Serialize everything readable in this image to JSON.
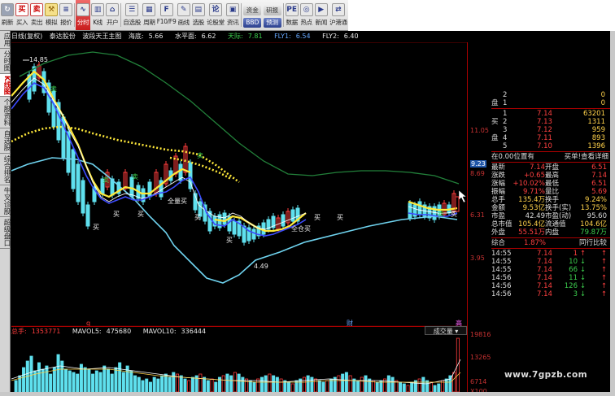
{
  "toolbar": {
    "items": [
      {
        "icon": "refresh-icon",
        "glyph": "↻",
        "label": "刷新",
        "style": "gray"
      },
      {
        "icon": "buy-icon",
        "glyph": "买",
        "label": "买入",
        "style": "reddish"
      },
      {
        "icon": "sell-icon",
        "glyph": "卖",
        "label": "卖出",
        "style": "reddish"
      },
      {
        "icon": "simulate-icon",
        "glyph": "⚒",
        "label": "模拟",
        "style": "gold"
      },
      {
        "icon": "quote-icon",
        "glyph": "≡",
        "label": "报价",
        "style": ""
      },
      {
        "icon": "timeshare-icon",
        "glyph": "∿",
        "label": "分时",
        "style": "active"
      },
      {
        "icon": "kline-icon",
        "glyph": "▥",
        "label": "K线",
        "style": ""
      },
      {
        "icon": "home-icon",
        "glyph": "⌂",
        "label": "开户",
        "style": ""
      },
      {
        "icon": "watchlist-icon",
        "glyph": "☰",
        "label": "自选股",
        "style": ""
      },
      {
        "icon": "period-icon",
        "glyph": "▦",
        "label": "周期",
        "style": ""
      },
      {
        "icon": "f10-icon",
        "glyph": "F",
        "label": "F10/F9",
        "style": ""
      },
      {
        "icon": "draw-icon",
        "glyph": "✎",
        "label": "画线",
        "style": ""
      },
      {
        "icon": "select-stock-icon",
        "glyph": "▤",
        "label": "选股",
        "style": ""
      },
      {
        "icon": "forum-icon",
        "glyph": "论",
        "label": "论股堂",
        "style": ""
      },
      {
        "icon": "news-icon",
        "glyph": "▣",
        "label": "资讯",
        "style": ""
      }
    ],
    "pills": [
      {
        "icon": "bbd-icon",
        "top": "资金",
        "bottom": "BBD"
      },
      {
        "icon": "research-icon",
        "top": "研报",
        "bottom": "预测"
      }
    ],
    "tail": [
      {
        "icon": "pe-icon",
        "glyph": "PE",
        "label": "数据"
      },
      {
        "icon": "hotspot-icon",
        "glyph": "◎",
        "label": "热点"
      },
      {
        "icon": "news-tv-icon",
        "glyph": "▶",
        "label": "新闻"
      },
      {
        "icon": "hk-connect-icon",
        "glyph": "⇄",
        "label": "沪港通"
      }
    ]
  },
  "sidebar": {
    "tabs": [
      {
        "label": "应用",
        "active": false
      },
      {
        "label": "分时图",
        "active": false
      },
      {
        "label": "K线图",
        "active": true
      },
      {
        "label": "个股资料",
        "active": false
      },
      {
        "label": "自选股",
        "active": false
      },
      {
        "label": "综合排名",
        "active": false
      },
      {
        "label": "牛叉诊股",
        "active": false
      },
      {
        "label": "超级盘口",
        "active": false
      }
    ]
  },
  "chart_title": {
    "period": "日线(复权)",
    "stock": "泰达股份",
    "indicator": "波段天王主图",
    "haidi_label": "海底:",
    "haidi_value": "5.66",
    "shuiping_label": "水平面:",
    "shuiping_value": "6.62",
    "tianji_label": "天际:",
    "tianji_value": "7.81",
    "fly1_label": "FLY1:",
    "fly1_value": "6.54",
    "fly2_label": "FLY2:",
    "fly2_value": "6.40"
  },
  "main_axis": {
    "labels": [
      "11.05",
      "9.23",
      "8.69",
      "6.31",
      "3.95"
    ],
    "highlight": "9.23"
  },
  "annotations": {
    "high": "14.85",
    "low": "4.49",
    "full_buy_1": "全量买",
    "full_buy_2": "全仓买",
    "buy": "买",
    "sell": "卖",
    "q_marker": "q",
    "cai_marker": "财",
    "gao_marker": "高"
  },
  "chart_data": {
    "type": "line",
    "candles": [],
    "series": [
      {
        "color": "#22803a"
      },
      {
        "color": "#ffe93a"
      },
      {
        "color": "#ffffff"
      },
      {
        "color": "#3c4bff"
      },
      {
        "color": "#6fd3ef"
      }
    ]
  },
  "volume": {
    "total_label": "总手:",
    "total_value": "1353771",
    "mavol5_label": "MAVOL5:",
    "mavol5_value": "475680",
    "mavol10_label": "MAVOL10:",
    "mavol10_value": "336444",
    "selector": "成交量",
    "axis_labels": [
      "19816",
      "13265",
      "6714",
      "X100"
    ]
  },
  "quote": {
    "sell_rows": [
      {
        "side": "",
        "level": "2",
        "price": "",
        "volume": "0"
      },
      {
        "side": "盘",
        "level": "1",
        "price": "",
        "volume": "0"
      }
    ],
    "buy_rows": [
      {
        "side": "",
        "level": "1",
        "price": "7.14",
        "volume": "63201"
      },
      {
        "side": "买",
        "level": "2",
        "price": "7.13",
        "volume": "1311"
      },
      {
        "side": "",
        "level": "3",
        "price": "7.12",
        "volume": "959"
      },
      {
        "side": "盘",
        "level": "4",
        "price": "7.11",
        "volume": "893"
      },
      {
        "side": "",
        "level": "5",
        "price": "7.10",
        "volume": "1396"
      }
    ],
    "position_left": "在0.00位置有",
    "position_right": "买单!查看详细",
    "stats": [
      {
        "l1": "最新",
        "v1": "7.14",
        "c1": "pos",
        "l2": "开盘",
        "v2": "6.51",
        "c2": "pos"
      },
      {
        "l1": "涨跌",
        "v1": "+0.65",
        "c1": "pos",
        "l2": "最高",
        "v2": "7.14",
        "c2": "pos"
      },
      {
        "l1": "涨幅",
        "v1": "+10.02%",
        "c1": "pos",
        "l2": "最低",
        "v2": "6.51",
        "c2": "pos"
      },
      {
        "l1": "振幅",
        "v1": "9.71%",
        "c1": "pos",
        "l2": "量比",
        "v2": "5.69",
        "c2": "pos"
      },
      {
        "l1": "总手",
        "v1": "135.4万",
        "c1": "yel",
        "l2": "换手",
        "v2": "9.24%",
        "c2": "yel"
      },
      {
        "l1": "金额",
        "v1": "9.53亿",
        "c1": "yel",
        "l2": "换手(实)",
        "v2": "13.75%",
        "c2": "yel"
      },
      {
        "l1": "市盈",
        "v1": "42.49",
        "c1": "neu",
        "l2": "市盈(动)",
        "v2": "95.60",
        "c2": "neu"
      },
      {
        "l1": "总市值",
        "v1": "105.4亿",
        "c1": "yel",
        "l2": "流通值",
        "v2": "104.6亿",
        "c2": "yel"
      },
      {
        "l1": "外盘",
        "v1": "55.51万",
        "c1": "pos",
        "l2": "内盘",
        "v2": "79.87万",
        "c2": "neg"
      }
    ],
    "rank_label": "综合",
    "rank_value": "1.87%",
    "rank_right": "同行比较",
    "ticks": [
      {
        "time": "14:55",
        "price": "7.14",
        "vol": "1",
        "dir": "up",
        "cls": "pos"
      },
      {
        "time": "14:55",
        "price": "7.14",
        "vol": "10",
        "dir": "down",
        "cls": "neg"
      },
      {
        "time": "14:55",
        "price": "7.14",
        "vol": "66",
        "dir": "down",
        "cls": "neg"
      },
      {
        "time": "14:56",
        "price": "7.14",
        "vol": "11",
        "dir": "down",
        "cls": "neg"
      },
      {
        "time": "14:56",
        "price": "7.14",
        "vol": "126",
        "dir": "down",
        "cls": "neg"
      },
      {
        "time": "14:56",
        "price": "7.14",
        "vol": "3",
        "dir": "down",
        "cls": "neg"
      }
    ]
  },
  "watermark": "www.7gpzb.com"
}
